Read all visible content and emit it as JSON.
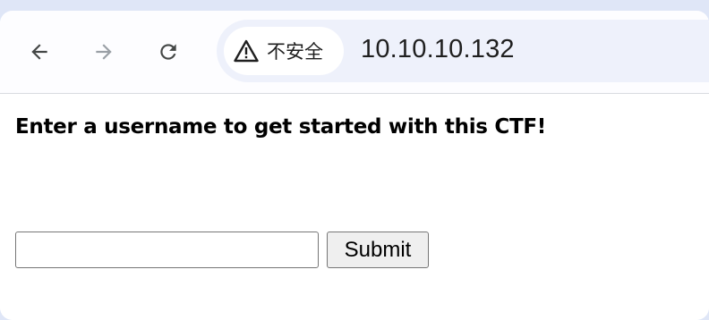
{
  "browser": {
    "back_icon": "arrow-left-icon",
    "forward_icon": "arrow-right-icon",
    "reload_icon": "reload-icon",
    "security_icon": "warning-triangle-icon",
    "security_label": "不安全",
    "url": "10.10.10.132",
    "back_enabled": true,
    "forward_enabled": false
  },
  "page": {
    "heading": "Enter a username to get started with this CTF!",
    "username_value": "",
    "submit_label": "Submit"
  },
  "colors": {
    "frame_bg": "#dfe6f7",
    "omnibox_bg": "#eef1fb",
    "icon_active": "#444746",
    "icon_disabled": "#9aa0a6"
  }
}
